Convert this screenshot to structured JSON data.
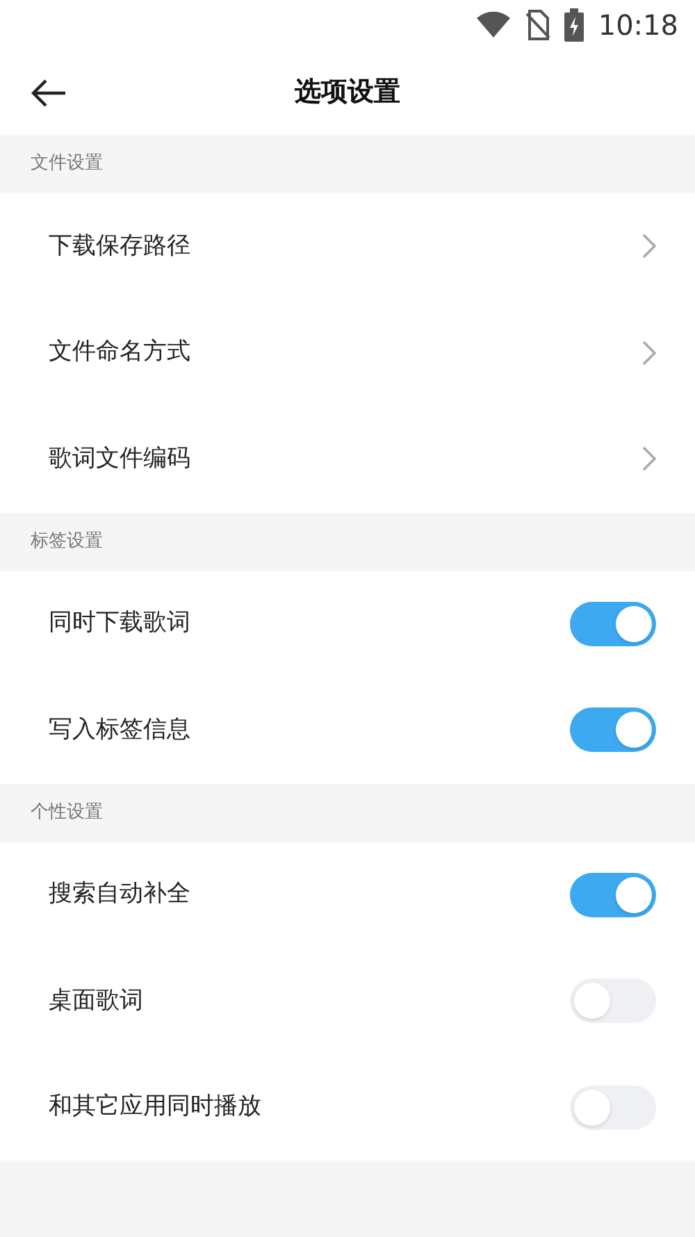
{
  "status_bar": {
    "time": "10:18"
  },
  "header": {
    "title": "选项设置"
  },
  "sections": [
    {
      "title": "文件设置",
      "items": [
        {
          "kind": "link",
          "label": "下载保存路径"
        },
        {
          "kind": "link",
          "label": "文件命名方式"
        },
        {
          "kind": "link",
          "label": "歌词文件编码"
        }
      ]
    },
    {
      "title": "标签设置",
      "items": [
        {
          "kind": "toggle",
          "label": "同时下载歌词",
          "on": true
        },
        {
          "kind": "toggle",
          "label": "写入标签信息",
          "on": true
        }
      ]
    },
    {
      "title": "个性设置",
      "items": [
        {
          "kind": "toggle",
          "label": "搜索自动补全",
          "on": true
        },
        {
          "kind": "toggle",
          "label": "桌面歌词",
          "on": false
        },
        {
          "kind": "toggle",
          "label": "和其它应用同时播放",
          "on": false
        }
      ]
    }
  ]
}
